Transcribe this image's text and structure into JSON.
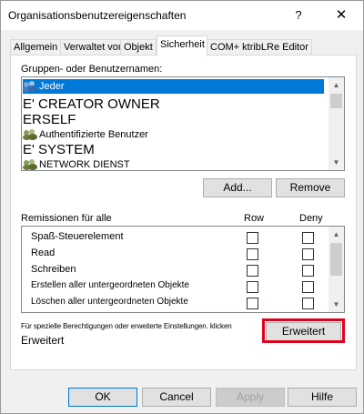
{
  "window": {
    "title": "Organisationsbenutzereigenschaften",
    "help": "?",
    "close": "✕"
  },
  "tabs": [
    {
      "label": "Allgemein"
    },
    {
      "label": "Verwaltet von"
    },
    {
      "label": "Objekt"
    },
    {
      "label": "Sicherheit"
    },
    {
      "label": "COM+ ktribLRe Editor"
    }
  ],
  "groups": {
    "label": "Gruppen- oder Benutzernamen:",
    "items": [
      {
        "label": "Jeder",
        "icon": "users-icon"
      },
      {
        "label": "E' CREATOR OWNER",
        "icon": ""
      },
      {
        "label": "ERSELF",
        "icon": ""
      },
      {
        "label": "Authentifizierte Benutzer",
        "icon": "users-icon"
      },
      {
        "label": "E' SYSTEM",
        "icon": ""
      },
      {
        "label": "NETWORK DIENST",
        "icon": "users-icon"
      }
    ],
    "add_button": "Add...",
    "remove_button": "Remove"
  },
  "permissions": {
    "label": "Remissionen für alle",
    "allow_header": "Row",
    "deny_header": "Deny",
    "items": [
      {
        "name": "Spaß-Steuerelement",
        "allow": false,
        "deny": false
      },
      {
        "name": "Read",
        "allow": false,
        "deny": false
      },
      {
        "name": "Schreiben",
        "allow": false,
        "deny": false
      },
      {
        "name": "Erstellen aller untergeordneten Objekte",
        "allow": false,
        "deny": false
      },
      {
        "name": "Löschen aller untergeordneten Objekte",
        "allow": false,
        "deny": false
      }
    ]
  },
  "advanced": {
    "text_line1": "Für spezielle Berechtigungen oder erweiterte Einstellungen. klicken",
    "text_line2": "Erweitert",
    "button": "Erweitert"
  },
  "footer": {
    "ok": "OK",
    "cancel": "Cancel",
    "apply": "Apply",
    "help": "Hilfe"
  },
  "colors": {
    "selection": "#0078d7",
    "highlight_frame": "#e0001b"
  }
}
